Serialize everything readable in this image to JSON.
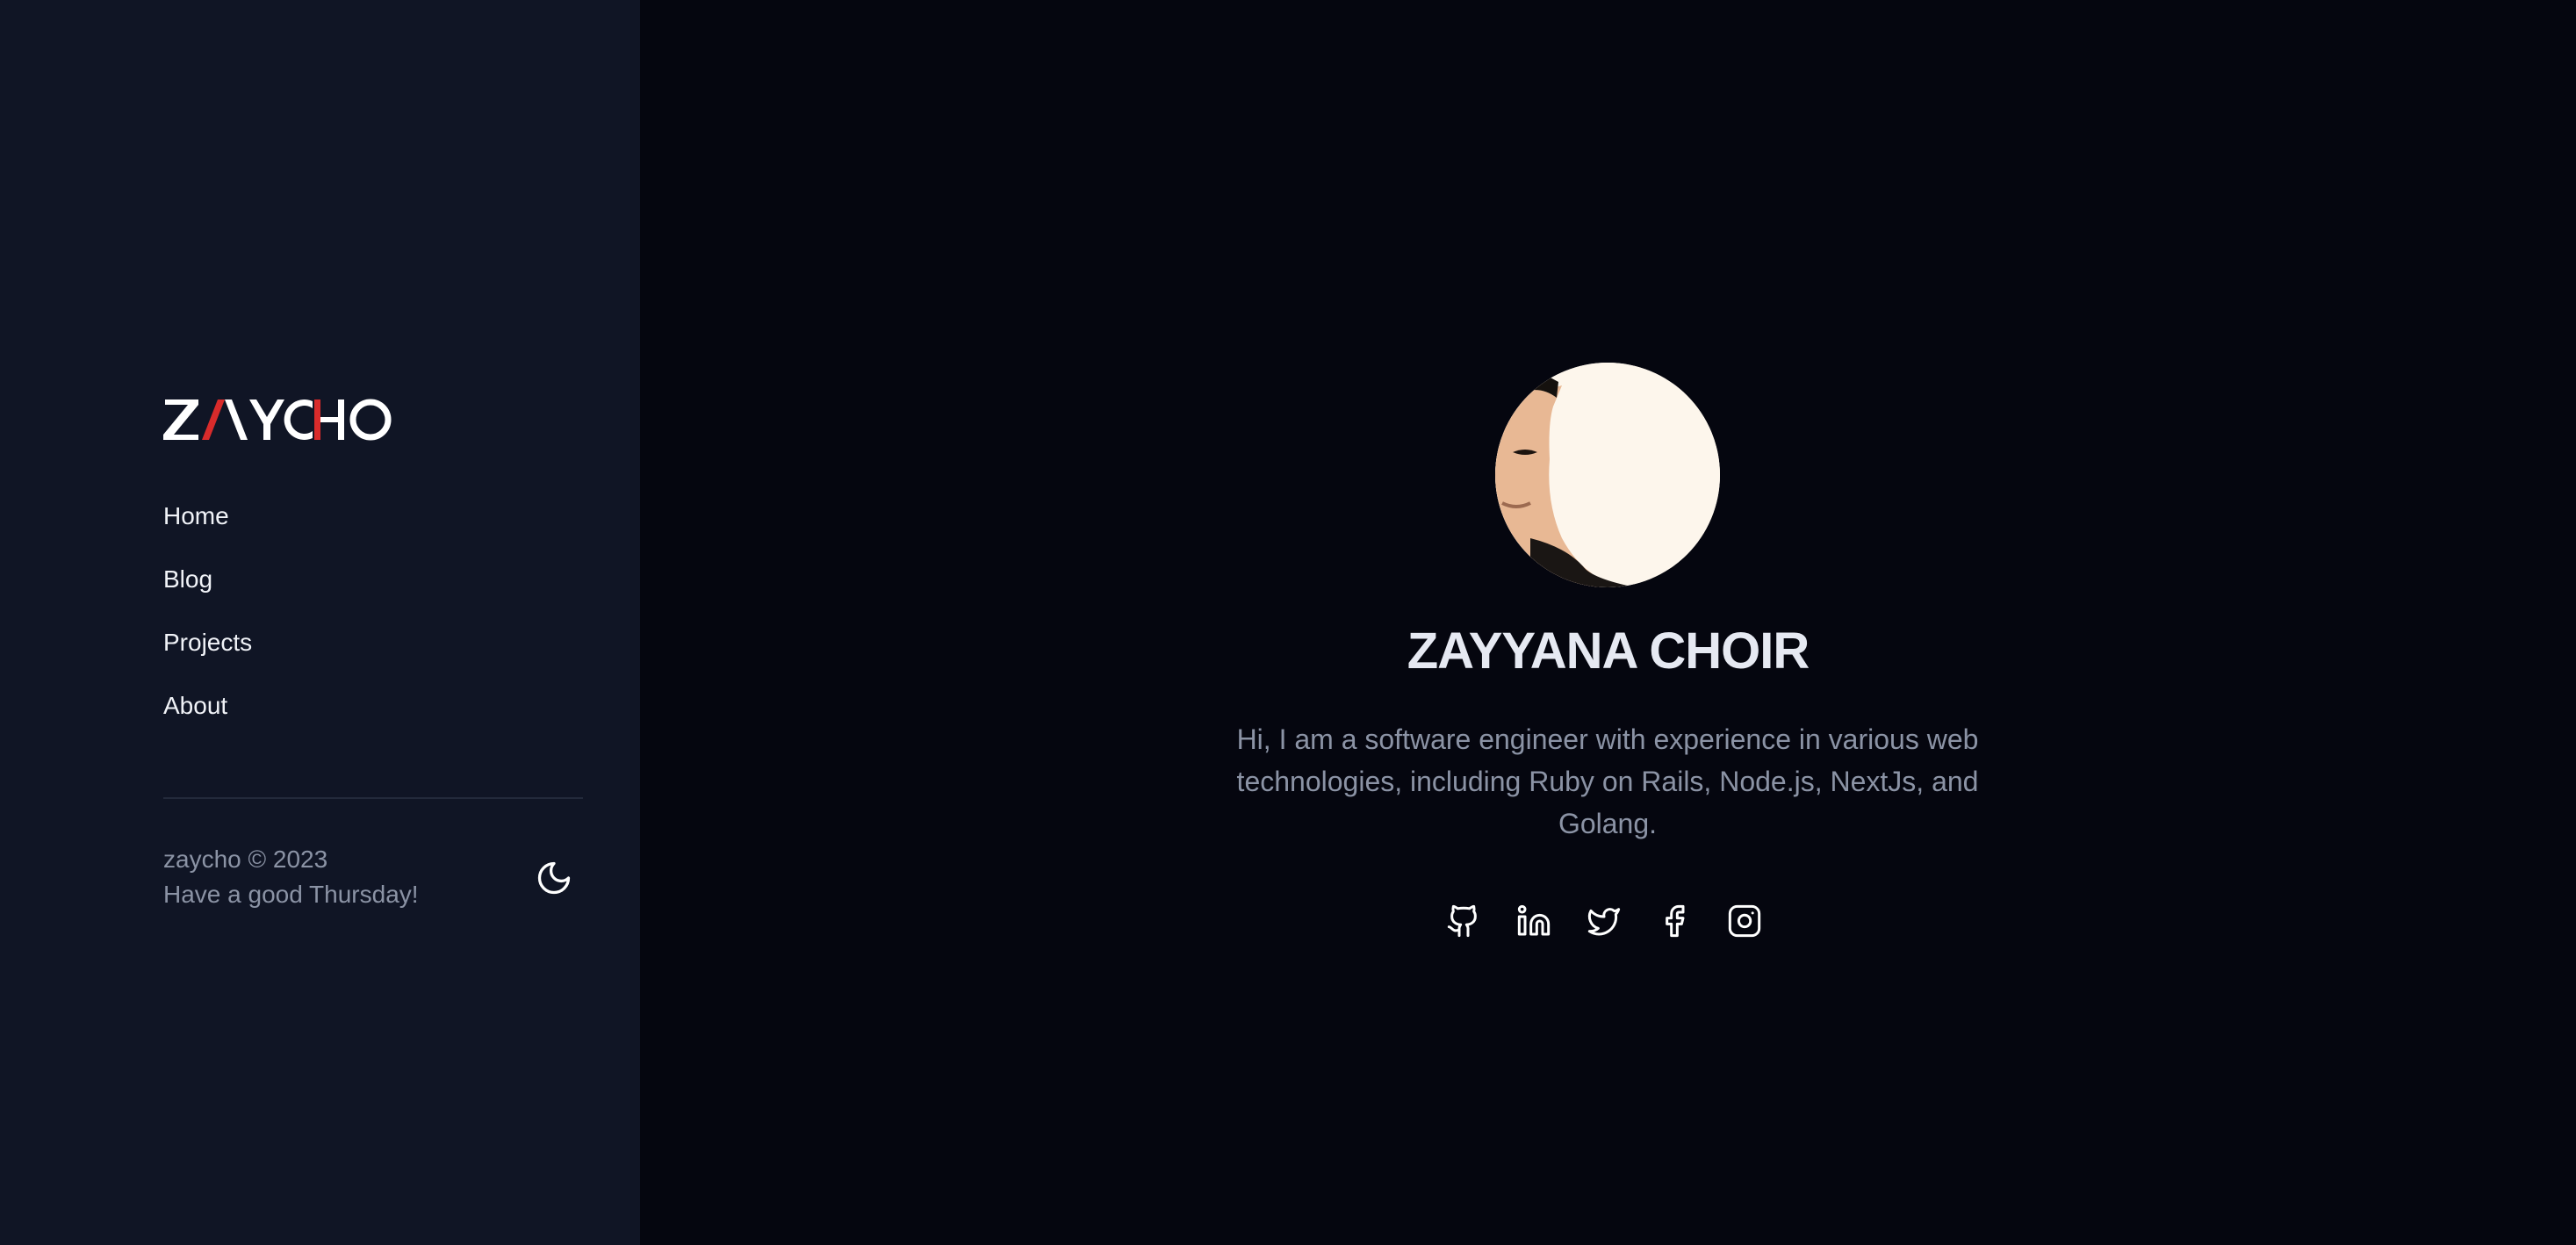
{
  "sidebar": {
    "logo_text": "ZAYCHO",
    "nav": [
      {
        "label": "Home"
      },
      {
        "label": "Blog"
      },
      {
        "label": "Projects"
      },
      {
        "label": "About"
      }
    ],
    "footer": {
      "copyright": "zaycho © 2023",
      "greeting": "Have a good Thursday!"
    },
    "theme_toggle_icon": "moon-icon"
  },
  "main": {
    "name": "ZAYYANA CHOIR",
    "bio": "Hi, I am a software engineer with experience in various web technologies, including Ruby on Rails, Node.js, NextJs, and Golang.",
    "socials": [
      {
        "icon": "github-icon"
      },
      {
        "icon": "linkedin-icon"
      },
      {
        "icon": "twitter-icon"
      },
      {
        "icon": "facebook-icon"
      },
      {
        "icon": "instagram-icon"
      }
    ]
  },
  "colors": {
    "sidebar_bg": "#101525",
    "main_bg": "#05060f",
    "logo_accent": "#d92b2b",
    "text_primary": "#f1f3f8",
    "text_muted": "#8b93a5"
  }
}
